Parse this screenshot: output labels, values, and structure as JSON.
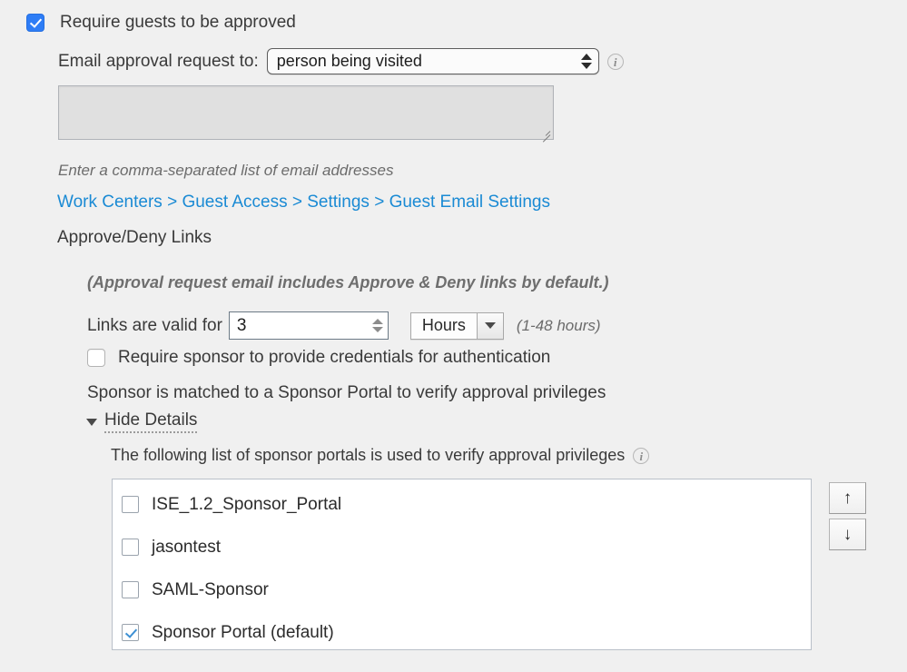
{
  "require_guests": {
    "label": "Require guests to be approved",
    "checked": true
  },
  "email_approval": {
    "label": "Email approval request to:",
    "selected": "person being visited",
    "info_icon": "info-icon",
    "info_glyph": "i"
  },
  "email_list": {
    "value": "",
    "placeholder": "",
    "helper": "Enter a comma-separated list of email addresses"
  },
  "breadcrumb": {
    "text": "Work Centers > Guest Access > Settings > Guest Email Settings",
    "color": "#1a8ad4"
  },
  "approve_deny": {
    "heading": "Approve/Deny Links",
    "note": "(Approval request email includes Approve & Deny links by default.)"
  },
  "links_valid": {
    "label": "Links are valid for",
    "value": "3",
    "unit": "Hours",
    "hint": "(1-48 hours)"
  },
  "sponsor_credentials": {
    "label": "Require sponsor to provide credentials for authentication",
    "checked": false
  },
  "sponsor_matched": {
    "text": "Sponsor is matched to a Sponsor Portal to verify approval privileges"
  },
  "hide_details": {
    "label": "Hide Details",
    "caret_icon": "chevron-down-icon"
  },
  "portals": {
    "caption": "The following list of sponsor portals is used to verify approval privileges",
    "info_glyph": "i",
    "items": [
      {
        "name": "ISE_1.2_Sponsor_Portal",
        "checked": false
      },
      {
        "name": "jasontest",
        "checked": false
      },
      {
        "name": "SAML-Sponsor",
        "checked": false
      },
      {
        "name": "Sponsor Portal (default)",
        "checked": true
      }
    ],
    "move_up_glyph": "↑",
    "move_down_glyph": "↓"
  },
  "bottom": {
    "clipped_text": ""
  },
  "colors": {
    "background": "#f0f0f0",
    "accent_checkbox": "#2e7df6",
    "link": "#1a8ad4",
    "list_check": "#3d90d4",
    "text": "#3a3a3a",
    "muted_text": "#6b6b6b"
  }
}
